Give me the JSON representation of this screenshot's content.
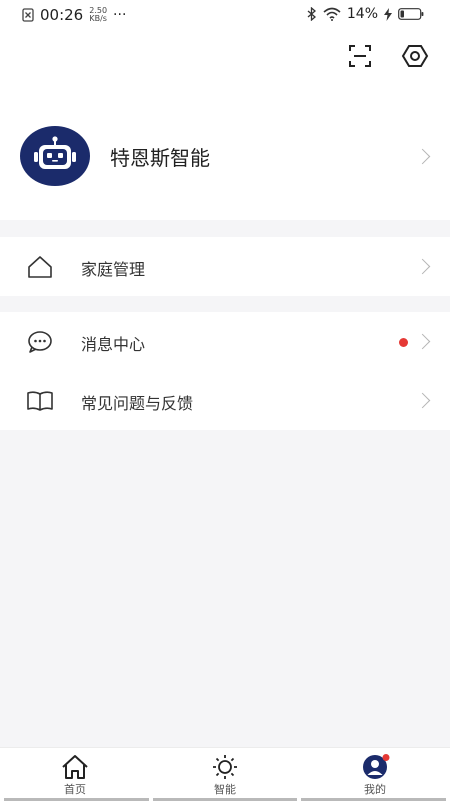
{
  "status_bar": {
    "time": "00:26",
    "speed_value": "2.50",
    "speed_unit": "KB/s",
    "more": "···",
    "battery": "14%"
  },
  "profile": {
    "name": "特恩斯智能"
  },
  "menu": {
    "family": "家庭管理",
    "messages": "消息中心",
    "faq": "常见问题与反馈"
  },
  "tabs": [
    {
      "label": "首页"
    },
    {
      "label": "智能"
    },
    {
      "label": "我的"
    }
  ],
  "colors": {
    "avatar_bg": "#1b2b6b",
    "badge": "#e53935",
    "background": "#f5f5f7"
  }
}
